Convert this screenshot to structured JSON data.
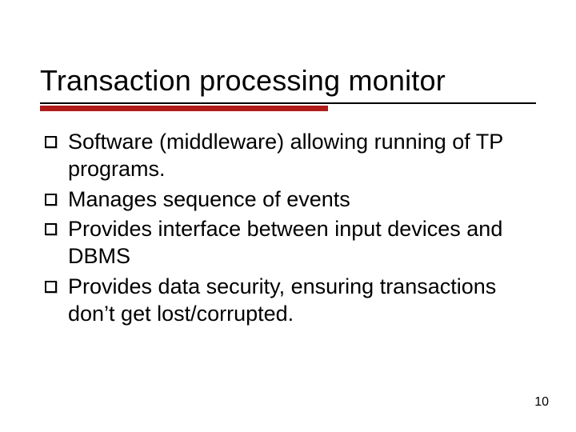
{
  "slide": {
    "title": "Transaction processing monitor",
    "bullets": [
      "Software (middleware) allowing running of TP programs.",
      "Manages sequence of events",
      "Provides interface between input devices and DBMS",
      "Provides data security, ensuring transactions don’t get lost/corrupted."
    ],
    "page_number": "10",
    "accent_color": "#b01c1a"
  }
}
